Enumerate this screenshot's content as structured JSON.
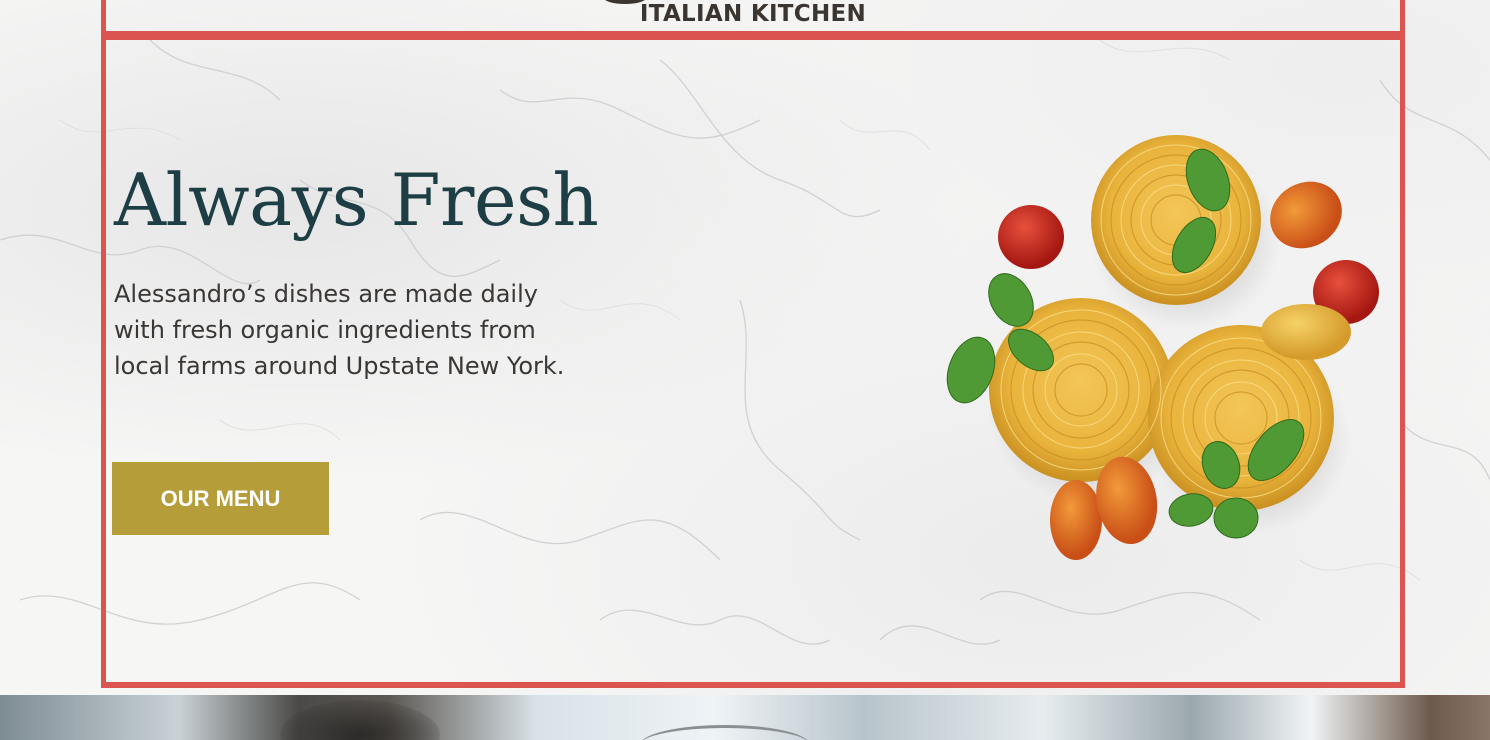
{
  "header": {
    "subtitle": "ITALIAN KITCHEN"
  },
  "hero": {
    "title": "Always Fresh",
    "description_lines": [
      "Alessandro’s dishes are made daily",
      "with fresh organic ingredients from",
      "local farms around Upstate New York."
    ],
    "cta_label": "OUR MENU"
  },
  "colors": {
    "frame_border": "#dc5450",
    "title": "#1d3e44",
    "button_bg": "#b59d39",
    "button_text": "#ffffff",
    "body_text": "#3a3735"
  },
  "icons": {
    "hero_image": "pasta-nests-with-tomatoes-and-basil"
  }
}
